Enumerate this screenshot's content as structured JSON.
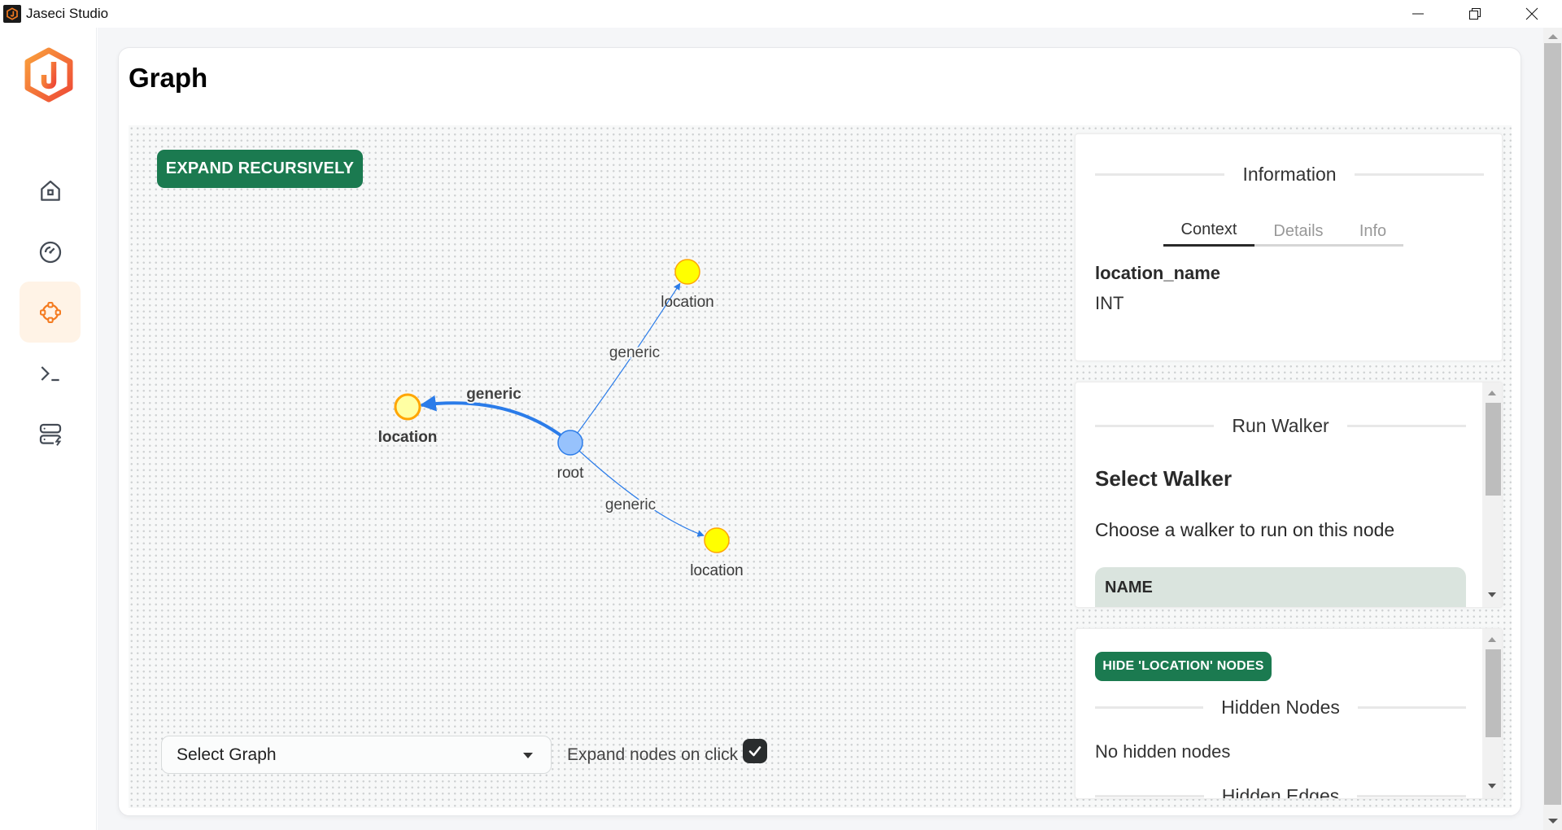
{
  "window": {
    "title": "Jaseci Studio",
    "controls": {
      "minimize": "minimize-icon",
      "restore": "restore-icon",
      "close": "close-icon"
    }
  },
  "sidebar": {
    "logo": "jaseci-logo",
    "items": [
      {
        "name": "home",
        "icon": "home-icon",
        "active": false
      },
      {
        "name": "dashboard",
        "icon": "gauge-icon",
        "active": false
      },
      {
        "name": "graph",
        "icon": "graph-nodes-icon",
        "active": true
      },
      {
        "name": "terminal",
        "icon": "terminal-icon",
        "active": false
      },
      {
        "name": "servers",
        "icon": "server-bolt-icon",
        "active": false
      }
    ]
  },
  "page": {
    "title": "Graph"
  },
  "toolbar": {
    "expand_recursively": "EXPAND RECURSIVELY"
  },
  "graph": {
    "nodes": [
      {
        "id": "root",
        "label": "root",
        "type": "root",
        "fill": "#97c2fc",
        "stroke": "#2b7ce9",
        "bold": false
      },
      {
        "id": "loc1",
        "label": "location",
        "type": "location",
        "fill": "#ffff00",
        "stroke": "#ffa500",
        "bold": false
      },
      {
        "id": "loc2",
        "label": "location",
        "type": "location",
        "fill": "#ffffa3",
        "stroke": "#ffa500",
        "bold": true,
        "selected": true
      },
      {
        "id": "loc3",
        "label": "location",
        "type": "location",
        "fill": "#ffff00",
        "stroke": "#ffa500",
        "bold": false
      }
    ],
    "edges": [
      {
        "from": "root",
        "to": "loc1",
        "label": "generic",
        "bold": false
      },
      {
        "from": "root",
        "to": "loc2",
        "label": "generic",
        "bold": true
      },
      {
        "from": "root",
        "to": "loc3",
        "label": "generic",
        "bold": false
      }
    ],
    "edge_color": "#2b7ce9"
  },
  "bottom_controls": {
    "select_graph": "Select Graph",
    "expand_on_click_label": "Expand nodes on click",
    "expand_on_click_checked": true
  },
  "info_panel": {
    "title": "Information",
    "tabs": [
      {
        "label": "Context",
        "active": true
      },
      {
        "label": "Details",
        "active": false
      },
      {
        "label": "Info",
        "active": false
      }
    ],
    "context": {
      "key": "location_name",
      "value": "INT"
    }
  },
  "walker_panel": {
    "title": "Run Walker",
    "heading": "Select Walker",
    "description": "Choose a walker to run on this node",
    "table_header": "NAME"
  },
  "hidden_panel": {
    "hide_button": "HIDE 'LOCATION' NODES",
    "hidden_nodes_title": "Hidden Nodes",
    "hidden_nodes_empty": "No hidden nodes",
    "hidden_edges_title": "Hidden Edges"
  },
  "colors": {
    "accent_orange": "#f47b20",
    "button_green": "#1b7a50",
    "active_nav_bg": "#fff3e6"
  }
}
